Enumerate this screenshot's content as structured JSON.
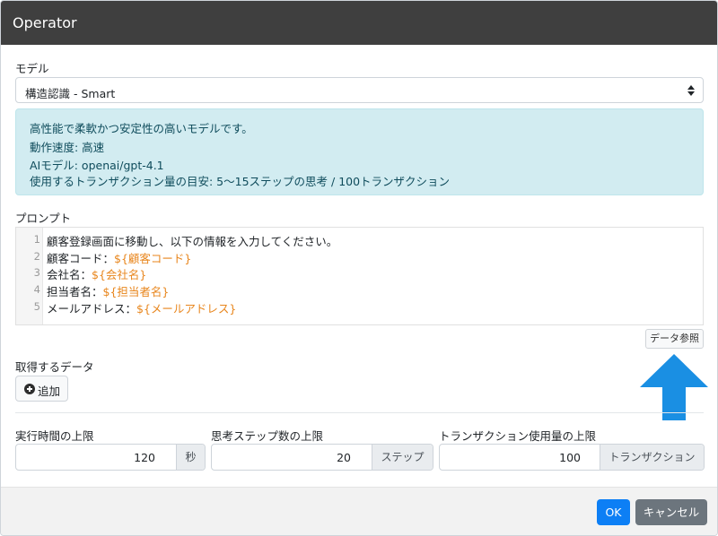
{
  "dialog": {
    "title": "Operator"
  },
  "model": {
    "label": "モデル",
    "selected": "構造認識 - Smart"
  },
  "model_info": {
    "lines": [
      "高性能で柔軟かつ安定性の高いモデルです。",
      "動作速度: 高速",
      "AIモデル: openai/gpt-4.1",
      "使用するトランザクション量の目安: 5〜15ステップの思考 / 100トランザクション"
    ]
  },
  "prompt": {
    "label": "プロンプト",
    "lines": [
      {
        "num": "1",
        "text": "顧客登録画面に移動し、以下の情報を入力してください。",
        "var": ""
      },
      {
        "num": "2",
        "text": "顧客コード：",
        "var": "${顧客コード}"
      },
      {
        "num": "3",
        "text": "会社名：",
        "var": "${会社名}"
      },
      {
        "num": "4",
        "text": "担当者名：",
        "var": "${担当者名}"
      },
      {
        "num": "5",
        "text": "メールアドレス：",
        "var": "${メールアドレス}"
      }
    ],
    "data_ref_label": "データ参照"
  },
  "fetch": {
    "label": "取得するデータ",
    "add_label": "追加"
  },
  "limits": {
    "time": {
      "label": "実行時間の上限",
      "value": "120",
      "unit": "秒"
    },
    "steps": {
      "label": "思考ステップ数の上限",
      "value": "20",
      "unit": "ステップ"
    },
    "transactions": {
      "label": "トランザクション使用量の上限",
      "value": "100",
      "unit": "トランザクション"
    }
  },
  "footer": {
    "ok_label": "OK",
    "cancel_label": "キャンセル"
  },
  "colors": {
    "titlebar": "#3f3f3f",
    "info_bg": "#d2ecf1",
    "variable": "#e8861d",
    "ok": "#0d7ff5",
    "cancel": "#6c757d",
    "arrow": "#1a8fe3"
  },
  "icons": {
    "add": "plus-circle-icon",
    "select": "select-arrows-icon",
    "callout": "up-arrow-icon"
  }
}
